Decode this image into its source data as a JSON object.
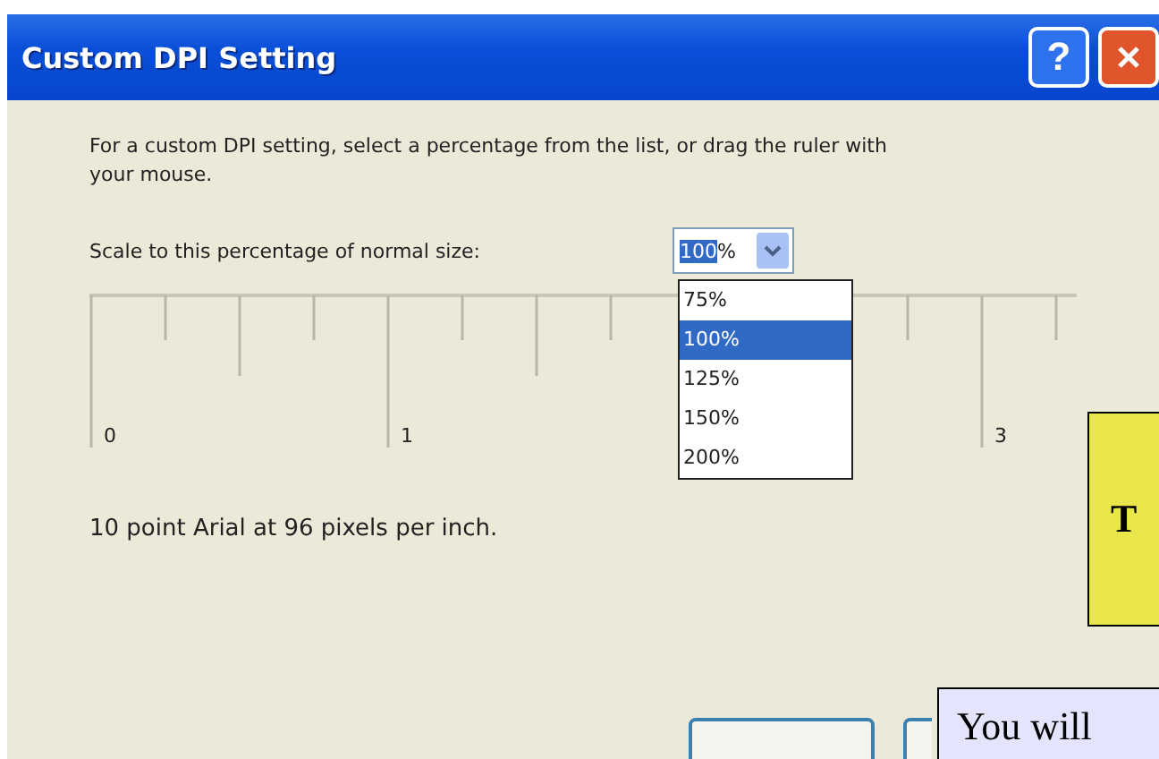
{
  "window": {
    "title": "Custom DPI Setting",
    "help_button": "?"
  },
  "instructions": "For a custom DPI setting, select a percentage from the list, or drag the ruler with your mouse.",
  "scale": {
    "label": "Scale to this percentage of normal size:",
    "value": "100",
    "unit": "%",
    "expanded": true,
    "options": [
      {
        "label": "75%",
        "selected": false
      },
      {
        "label": "100%",
        "selected": true
      },
      {
        "label": "125%",
        "selected": false
      },
      {
        "label": "150%",
        "selected": false
      },
      {
        "label": "200%",
        "selected": false
      }
    ]
  },
  "ruler": {
    "labels": [
      "0",
      "1",
      "3"
    ]
  },
  "sample_text": "10 point Arial at 96 pixels per inch.",
  "overlays": [
    {
      "kind": "note",
      "text": "T",
      "color": "#e8e64a"
    },
    {
      "kind": "callout",
      "text": "You will",
      "color": "#e4e4fc"
    }
  ]
}
